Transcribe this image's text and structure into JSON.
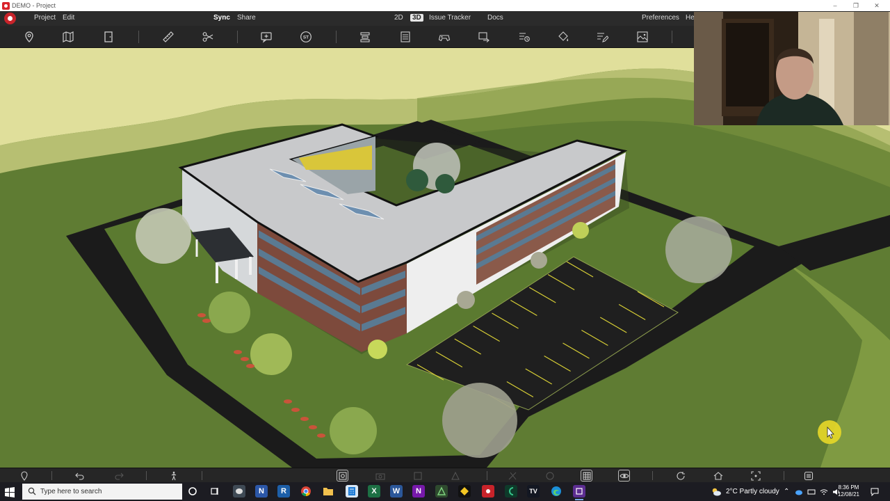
{
  "window": {
    "title": "DEMO - Project",
    "controls": [
      "–",
      "❐",
      "✕"
    ]
  },
  "menu": {
    "project": "Project",
    "edit": "Edit",
    "sync": "Sync",
    "share": "Share",
    "view_2d": "2D",
    "view_3d": "3D",
    "issue_tracker": "Issue Tracker",
    "docs": "Docs",
    "preferences": "Preferences",
    "help_partial": "He"
  },
  "bottom_toolbar": {
    "active_tool_icons": [
      "grid-icon",
      "eye-icon"
    ]
  },
  "taskbar": {
    "search_placeholder": "Type here to search",
    "weather": "2°C  Partly cloudy",
    "time": "8:36 PM",
    "date": "12/08/21"
  },
  "colors": {
    "accent": "#c8232a",
    "toolbar": "#262626",
    "grass": "#5e7a32",
    "asphalt": "#1c1c1c"
  }
}
